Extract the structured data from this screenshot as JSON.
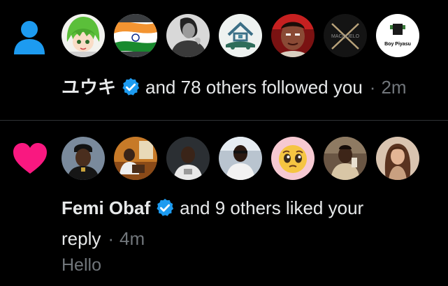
{
  "notifications": [
    {
      "type": "follow",
      "type_icon": "person-icon",
      "type_color": "#1d9bf0",
      "avatars": [
        {
          "name": "avatar-anime-green-hair"
        },
        {
          "name": "avatar-india-flag"
        },
        {
          "name": "avatar-person-bw"
        },
        {
          "name": "avatar-house-car-logo"
        },
        {
          "name": "avatar-person-red"
        },
        {
          "name": "avatar-macquelo-logo",
          "text": "MACQUELO"
        },
        {
          "name": "avatar-boy-piyasu-logo",
          "text": "Boy Piyasu"
        }
      ],
      "actor": "ユウキ",
      "verified": true,
      "text": "and 78 others followed you",
      "separator": "·",
      "time": "2m"
    },
    {
      "type": "like",
      "type_icon": "heart-icon",
      "type_color": "#f91880",
      "avatars": [
        {
          "name": "avatar-man-black-cap"
        },
        {
          "name": "avatar-man-orange-room"
        },
        {
          "name": "avatar-man-white-tee"
        },
        {
          "name": "avatar-man-outdoor"
        },
        {
          "name": "avatar-pleading-emoji",
          "text": "🥺"
        },
        {
          "name": "avatar-man-beard"
        },
        {
          "name": "avatar-woman-long-hair"
        }
      ],
      "actor": "Femi Obaf",
      "verified": true,
      "text_line1": "and 9 others liked your",
      "text_line2": "reply",
      "separator": "·",
      "time": "4m",
      "snippet": "Hello"
    }
  ],
  "colors": {
    "background": "#000000",
    "divider": "#2f3336",
    "text_primary": "#e7e9ea",
    "text_secondary": "#71767b",
    "verified_blue": "#1d9bf0"
  }
}
